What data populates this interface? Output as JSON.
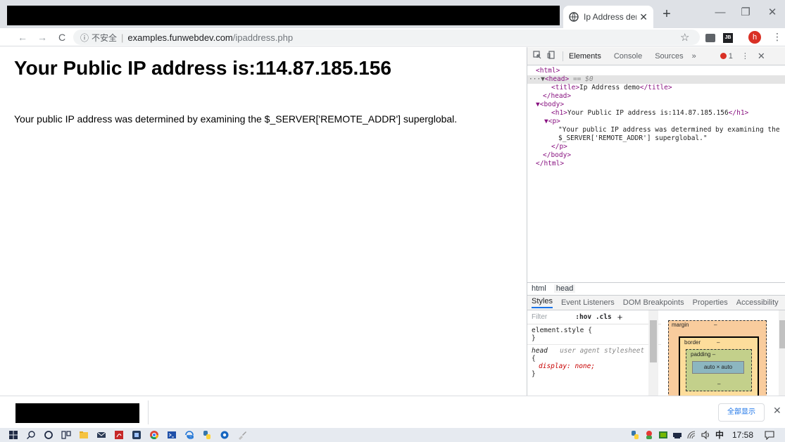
{
  "browser": {
    "tab_title": "Ip Address der",
    "tab_close": "✕",
    "new_tab": "+",
    "minimize": "—",
    "restore": "❐",
    "close": "✕",
    "back": "←",
    "forward": "→",
    "reload": "C",
    "security_icon": "ⓘ",
    "security_label": "不安全",
    "url_host": "examples.funwebdev.com",
    "url_path": "/ipaddress.php",
    "star": "☆",
    "profile_initial": "h",
    "menu": "⋮",
    "ext2_label": "JB"
  },
  "page": {
    "heading": "Your Public IP address is:114.87.185.156",
    "paragraph": "Your public IP address was determined by examining the $_SERVER['REMOTE_ADDR'] superglobal."
  },
  "devtools": {
    "tabs": [
      "Elements",
      "Console",
      "Sources"
    ],
    "more": "»",
    "error_count": "1",
    "kebab": "⋮",
    "close": "✕",
    "dom": {
      "l1": "<html>",
      "l2_dots": "···▼",
      "l2_tag": "<head>",
      "l2_eq": " == $0",
      "l3_open": "<title>",
      "l3_text": "Ip Address demo",
      "l3_close": "</title>",
      "l4": "</head>",
      "l5": "▼<body>",
      "l6_open": "<h1>",
      "l6_text": "Your Public IP address is:114.87.185.156",
      "l6_close": "</h1>",
      "l7": "▼<p>",
      "l8": "\"Your public IP address was determined by examining the",
      "l9": "$_SERVER['REMOTE_ADDR'] superglobal.\"",
      "l10": "</p>",
      "l11": "</body>",
      "l12": "</html>"
    },
    "breadcrumbs": [
      "html",
      "head"
    ],
    "sub_tabs": [
      "Styles",
      "Event Listeners",
      "DOM Breakpoints",
      "Properties",
      "Accessibility"
    ],
    "filter_placeholder": "Filter",
    "hov_cls": ":hov .cls",
    "add": "+",
    "rules": {
      "r1a": "element.style {",
      "r1b": "}",
      "r2_sel": "head",
      "r2_src": "user agent stylesheet",
      "r2_open": "{",
      "r2_prop": "display: none;",
      "r2_close": "}"
    },
    "boxmodel": {
      "margin": "margin",
      "margin_val": "–",
      "border": "border",
      "border_val": "–",
      "padding": "padding –",
      "content": "auto × auto",
      "padding_bottom": "–"
    }
  },
  "download_bar": {
    "show_all": "全部显示",
    "close": "✕"
  },
  "taskbar": {
    "ime": "中",
    "time": "17:58"
  }
}
